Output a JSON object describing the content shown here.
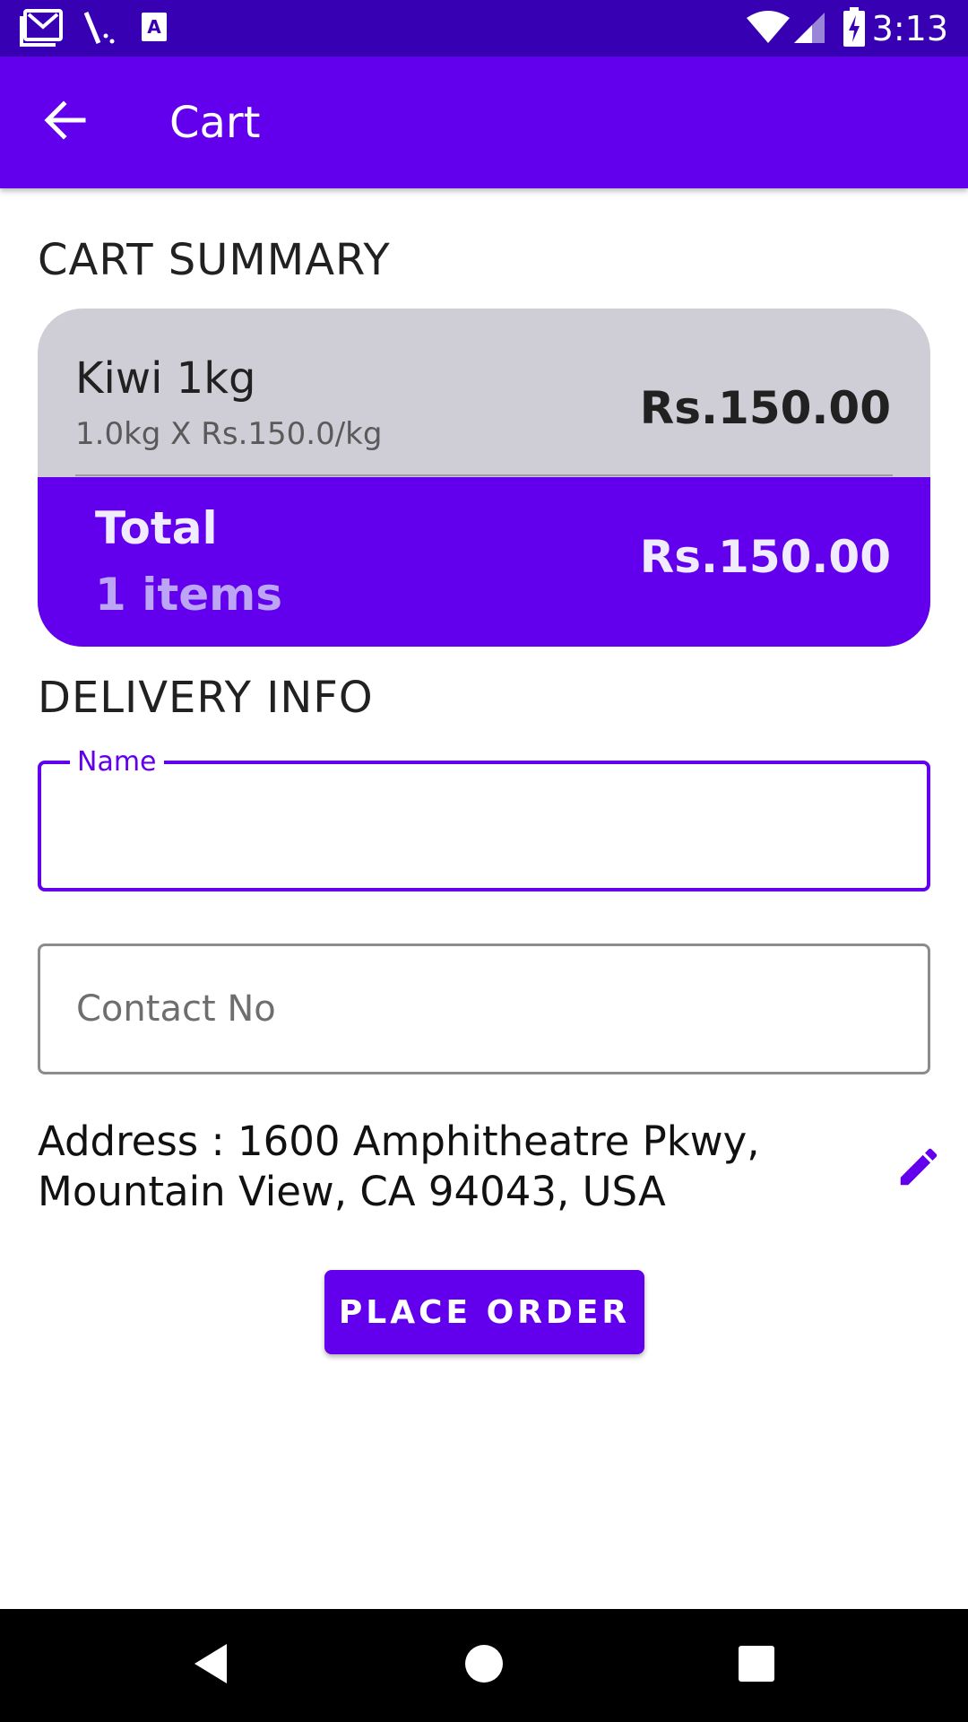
{
  "status_bar": {
    "time": "3:13",
    "left_icons": [
      "gmail-icon",
      "signal-strength-wedge-icon",
      "keyboard-a-icon"
    ],
    "right_icons": [
      "wifi-icon",
      "cellular-icon",
      "battery-charging-icon"
    ]
  },
  "app_bar": {
    "title": "Cart",
    "back_icon": "arrow-left-icon"
  },
  "cart_summary": {
    "heading": "CART SUMMARY",
    "items": [
      {
        "name": "Kiwi 1kg",
        "detail": "1.0kg X Rs.150.0/kg",
        "price": "Rs.150.00"
      }
    ],
    "total": {
      "label": "Total",
      "count": "1 items",
      "price": "Rs.150.00"
    }
  },
  "delivery_info": {
    "heading": "DELIVERY INFO",
    "name_field": {
      "label": "Name",
      "value": ""
    },
    "contact_field": {
      "placeholder": "Contact No",
      "value": ""
    },
    "address": "Address : 1600 Amphitheatre Pkwy, Mountain View, CA 94043, USA",
    "edit_icon": "pencil-icon"
  },
  "place_order_label": "PLACE ORDER",
  "nav_bar": {
    "icons": [
      "back-triangle-icon",
      "home-circle-icon",
      "recents-square-icon"
    ]
  },
  "colors": {
    "primary": "#6200ee",
    "primary_dark": "#3700b3",
    "card_background": "#cfcdd6",
    "total_count_text": "#bda5f5"
  }
}
